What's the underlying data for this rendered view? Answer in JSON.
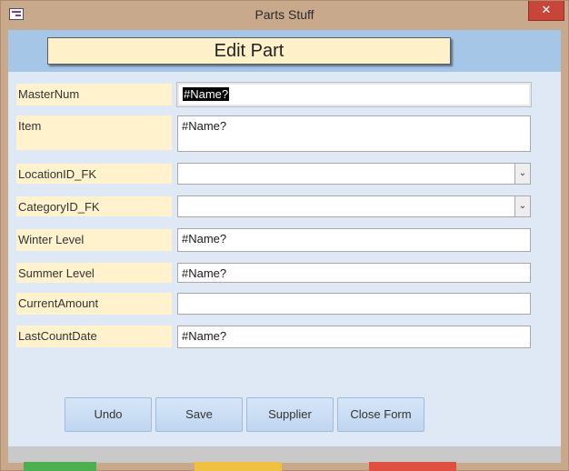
{
  "window": {
    "title": "Parts Stuff",
    "close_glyph": "✕",
    "app_icon": "form-icon"
  },
  "form": {
    "title": "Edit Part"
  },
  "fields": [
    {
      "label": "MasterNum",
      "value": "#Name?"
    },
    {
      "label": "Item",
      "value": "#Name?"
    },
    {
      "label": "LocationID_FK",
      "value": ""
    },
    {
      "label": "CategoryID_FK",
      "value": ""
    },
    {
      "label": "Winter Level",
      "value": "#Name?"
    },
    {
      "label": "Summer Level",
      "value": "#Name?"
    },
    {
      "label": "CurrentAmount",
      "value": ""
    },
    {
      "label": "LastCountDate",
      "value": "#Name?"
    }
  ],
  "combo_glyph": "⌄",
  "buttons": {
    "undo": "Undo",
    "save": "Save",
    "supplier": "Supplier",
    "close_form": "Close Form"
  },
  "colors": {
    "label_bg": "#fff2cc",
    "header_band": "#a6c6e8",
    "client_bg": "#dfe9f5",
    "close_button": "#c8453a"
  }
}
